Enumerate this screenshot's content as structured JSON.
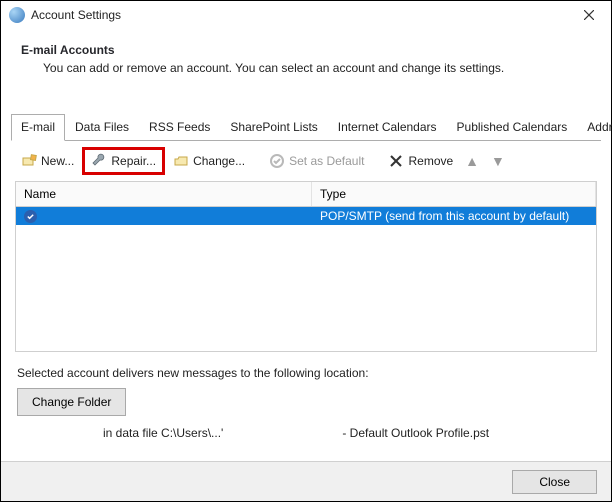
{
  "window": {
    "title": "Account Settings",
    "close_label": "Close"
  },
  "header": {
    "h1": "E-mail Accounts",
    "sub": "You can add or remove an account. You can select an account and change its settings."
  },
  "tabs": [
    {
      "id": "email",
      "label": "E-mail",
      "active": true
    },
    {
      "id": "data-files",
      "label": "Data Files"
    },
    {
      "id": "rss-feeds",
      "label": "RSS Feeds"
    },
    {
      "id": "sharepoint-lists",
      "label": "SharePoint Lists"
    },
    {
      "id": "internet-calendars",
      "label": "Internet Calendars"
    },
    {
      "id": "published-calendars",
      "label": "Published Calendars"
    },
    {
      "id": "address-books",
      "label": "Address Books"
    }
  ],
  "toolbar": {
    "new": "New...",
    "repair": "Repair...",
    "change": "Change...",
    "set_default": "Set as Default",
    "remove": "Remove"
  },
  "list": {
    "columns": {
      "name": "Name",
      "type": "Type"
    },
    "rows": [
      {
        "name": "",
        "type": "POP/SMTP (send from this account by default)",
        "default": true,
        "selected": true
      }
    ]
  },
  "footer": {
    "note": "Selected account delivers new messages to the following location:",
    "change_folder": "Change Folder",
    "path_prefix": "in data file C:\\Users\\...'",
    "path_suffix": "- Default Outlook Profile.pst"
  },
  "bottom": {
    "close": "Close"
  }
}
